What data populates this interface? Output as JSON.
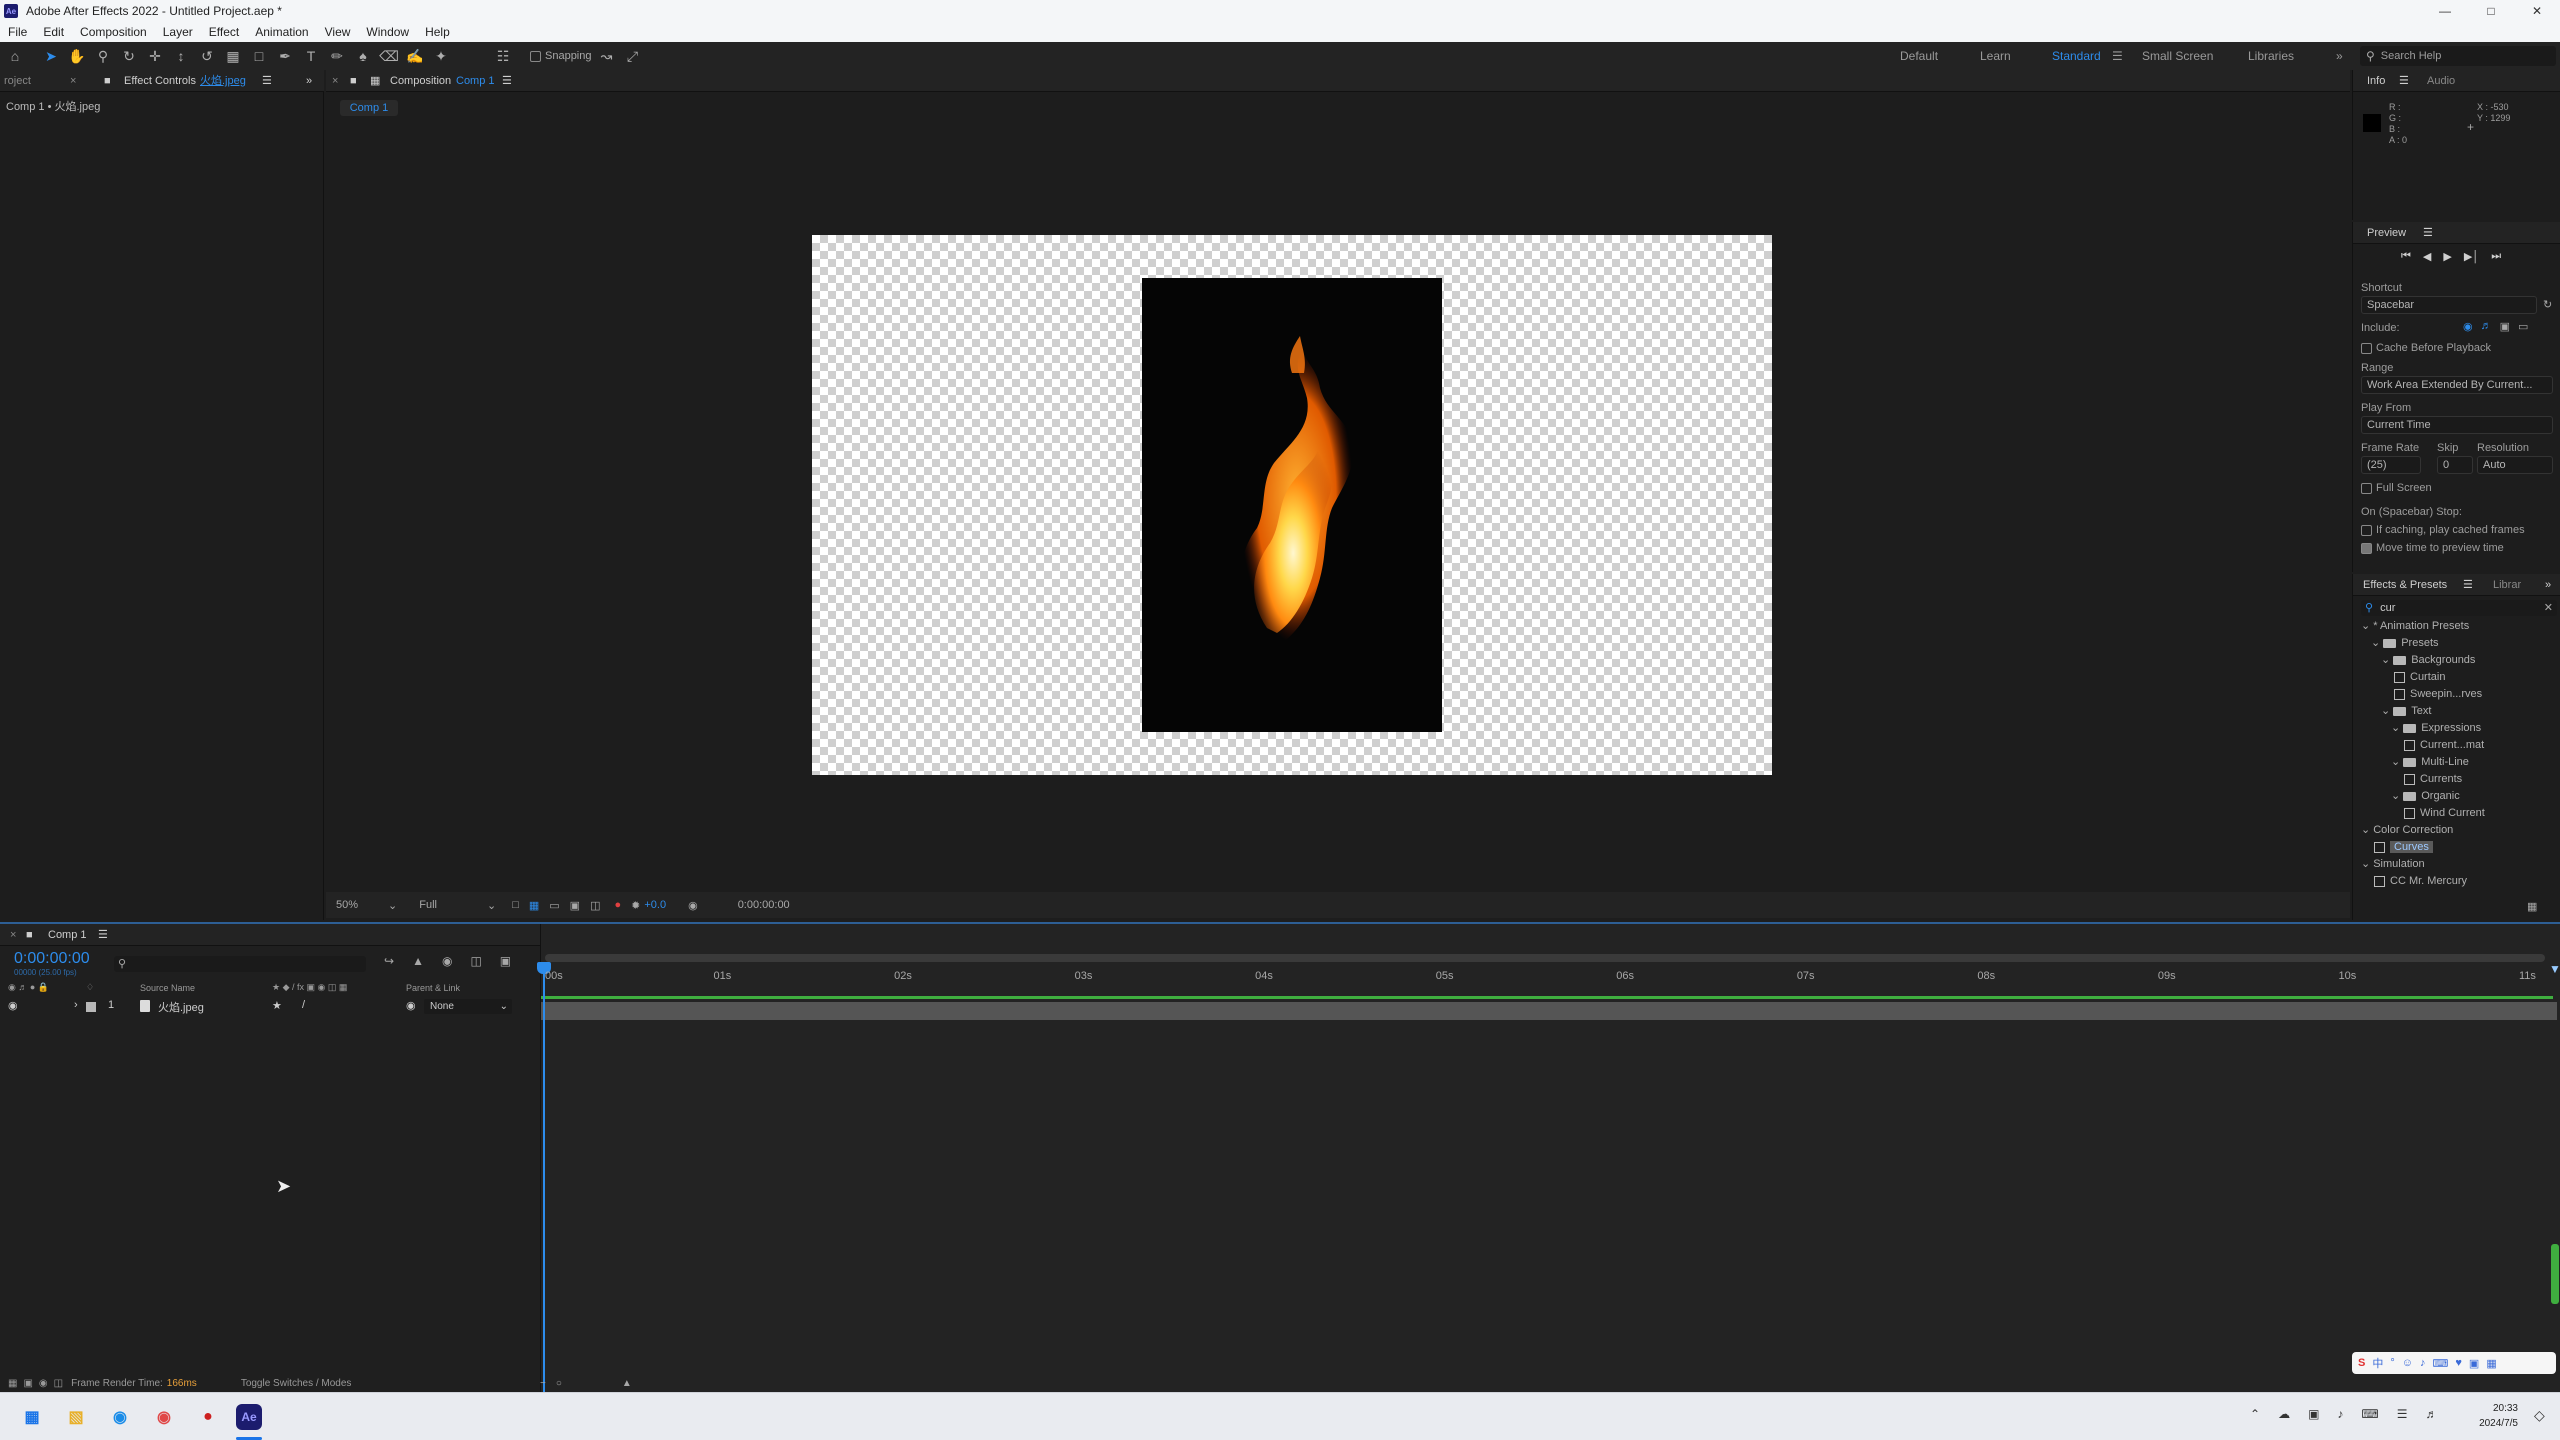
{
  "window": {
    "title": "Adobe After Effects 2022 - Untitled Project.aep *"
  },
  "menu": [
    "File",
    "Edit",
    "Composition",
    "Layer",
    "Effect",
    "Animation",
    "View",
    "Window",
    "Help"
  ],
  "toolbar": {
    "snapping_label": "Snapping"
  },
  "workspaces": {
    "items": [
      "Default",
      "Learn",
      "Standard",
      "Small Screen",
      "Libraries"
    ],
    "active": "Standard",
    "search_placeholder": "Search Help"
  },
  "left_panel": {
    "tab_project": "roject",
    "tab_effect_controls": "Effect Controls",
    "effect_controls_file": "火焰.jpeg",
    "breadcrumb": "Comp 1 • 火焰.jpeg"
  },
  "comp_panel": {
    "tab_label": "Composition",
    "tab_comp": "Comp 1",
    "sub_tab": "Comp 1",
    "zoom": "50%",
    "resolution": "Full",
    "exposure": "+0.0",
    "timecode": "0:00:00:00"
  },
  "info_panel": {
    "tab_info": "Info",
    "tab_audio": "Audio",
    "r": "R :",
    "g": "G :",
    "b": "B :",
    "a": "A : 0",
    "x": "X : -530",
    "y": "Y : 1299"
  },
  "preview_panel": {
    "title": "Preview",
    "shortcut_label": "Shortcut",
    "shortcut_value": "Spacebar",
    "include_label": "Include:",
    "cache_before_playback": "Cache Before Playback",
    "range_label": "Range",
    "range_value": "Work Area Extended By Current...",
    "play_from_label": "Play From",
    "play_from_value": "Current Time",
    "frame_rate_label": "Frame Rate",
    "skip_label": "Skip",
    "resolution_label": "Resolution",
    "frame_rate_value": "(25)",
    "skip_value": "0",
    "resolution_value": "Auto",
    "full_screen": "Full Screen",
    "on_stop_label": "On (Spacebar) Stop:",
    "if_caching": "If caching, play cached frames",
    "move_time": "Move time to preview time"
  },
  "effects_panel": {
    "title": "Effects & Presets",
    "tab_libraries": "Librar",
    "search_value": "cur",
    "tree": [
      {
        "label": "* Animation Presets",
        "kind": "root",
        "depth": 0
      },
      {
        "label": "Presets",
        "kind": "folder",
        "depth": 1
      },
      {
        "label": "Backgrounds",
        "kind": "folder",
        "depth": 2
      },
      {
        "label": "Curtain",
        "kind": "preset",
        "depth": 3
      },
      {
        "label": "Sweepin...rves",
        "kind": "preset",
        "depth": 3
      },
      {
        "label": "Text",
        "kind": "folder",
        "depth": 2
      },
      {
        "label": "Expressions",
        "kind": "folder",
        "depth": 3
      },
      {
        "label": "Current...mat",
        "kind": "preset",
        "depth": 4
      },
      {
        "label": "Multi-Line",
        "kind": "folder",
        "depth": 3
      },
      {
        "label": "Currents",
        "kind": "preset",
        "depth": 4
      },
      {
        "label": "Organic",
        "kind": "folder",
        "depth": 3
      },
      {
        "label": "Wind Current",
        "kind": "preset",
        "depth": 4
      },
      {
        "label": "Color Correction",
        "kind": "root",
        "depth": 0
      },
      {
        "label": "Curves",
        "kind": "preset-hl",
        "depth": 1
      },
      {
        "label": "Simulation",
        "kind": "root",
        "depth": 0
      },
      {
        "label": "CC Mr. Mercury",
        "kind": "preset",
        "depth": 1
      }
    ]
  },
  "timeline": {
    "tab_label": "Comp 1",
    "timecode": "0:00:00:00",
    "timecode_sub": "00000 (25.00 fps)",
    "col_source_name": "Source Name",
    "col_parent": "Parent & Link",
    "layer_number": "1",
    "layer_name": "火焰.jpeg",
    "layer_parent": "None",
    "ruler": [
      "00s",
      "01s",
      "02s",
      "03s",
      "04s",
      "05s",
      "06s",
      "07s",
      "08s",
      "09s",
      "10s",
      "11s"
    ],
    "frame_render_label": "Frame Render Time:",
    "frame_render_value": "166ms",
    "toggle_label": "Toggle Switches / Modes"
  },
  "taskbar": {
    "time": "20:33",
    "date": "2024/7/5",
    "ime": "中"
  }
}
